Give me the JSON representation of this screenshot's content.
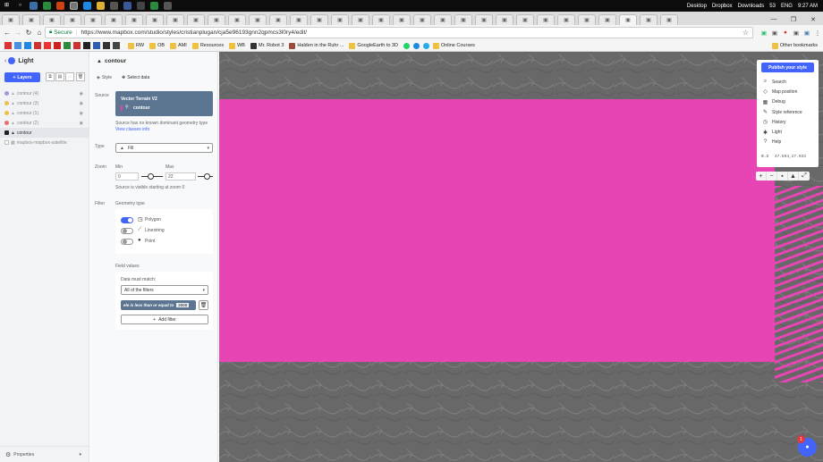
{
  "taskbar": {
    "right_items": [
      "Desktop",
      "Dropbox",
      "Downloads",
      "53",
      "ENG",
      "9:27 AM"
    ]
  },
  "addressbar": {
    "secure_label": "Secure",
    "url": "https://www.mapbox.com/studio/styles/cristianplugan/cja5e96193gnn2qpmcs3l0ry4/edit/"
  },
  "bookmarks": [
    {
      "label": "RW",
      "color": "#f0c040"
    },
    {
      "label": "OB",
      "color": "#f0c040"
    },
    {
      "label": "AMI",
      "color": "#f0c040"
    },
    {
      "label": "Resources",
      "color": "#f0c040"
    },
    {
      "label": "WB",
      "color": "#f0c040"
    },
    {
      "label": "Mr. Robot 3",
      "color": "#333333"
    },
    {
      "label": "Halden in the Ruhr ...",
      "color": "#9b4b3b"
    },
    {
      "label": "GoogleEarth to 3D",
      "color": "#f0c040"
    },
    {
      "label": "Online Courses",
      "color": "#f0c040"
    }
  ],
  "bookmarks_other": "Other bookmarks",
  "sidebar": {
    "style_name": "Light",
    "layers_button": "Layers",
    "layers": [
      {
        "name": "contour (4)",
        "color": "#9b9bdc",
        "selected": false
      },
      {
        "name": "contour (3)",
        "color": "#e8c050",
        "selected": false
      },
      {
        "name": "contour (1)",
        "color": "#f0c040",
        "selected": false
      },
      {
        "name": "contour (2)",
        "color": "#e87070",
        "selected": false
      },
      {
        "name": "contour",
        "color": "#222222",
        "selected": true
      },
      {
        "name": "mapbox-mapbox-satellite",
        "color": "#cccccc",
        "selected": false
      }
    ],
    "properties_label": "Properties"
  },
  "panel": {
    "layer_title": "contour",
    "tab_style": "Style",
    "tab_select_data": "Select data",
    "source_label": "Source",
    "source_name": "Vector Terrain V2",
    "source_layer": "contour",
    "source_note": "Source has no known dominant geometry type",
    "view_class_info": "View classes info",
    "type_label": "Type",
    "type_value": "Fill",
    "zoom_label": "Zoom",
    "min_label": "Min",
    "max_label": "Max",
    "min_value": "0",
    "max_value": "22",
    "zoom_note": "Source is visible starting at zoom 0",
    "filter_label": "Filter",
    "geometry_type_label": "Geometry type",
    "geom_polygon": "Polygon",
    "geom_linestring": "Linestring",
    "geom_point": "Point",
    "field_values_label": "Field values",
    "data_must_match": "Data must match:",
    "match_value": "All of the filters",
    "filter_text": "ele is less than or equal to",
    "filter_number": "2000",
    "add_filter": "Add filter"
  },
  "map": {
    "fill_color": "#e845b4",
    "publish_button": "Publish your style",
    "menu": [
      {
        "label": "Search",
        "icon": "search-icon"
      },
      {
        "label": "Map position",
        "icon": "map-position-icon"
      },
      {
        "label": "Debug",
        "icon": "debug-icon"
      },
      {
        "label": "Style reference",
        "icon": "style-reference-icon"
      },
      {
        "label": "History",
        "icon": "history-icon"
      },
      {
        "label": "Light",
        "icon": "light-icon"
      },
      {
        "label": "Help",
        "icon": "help-icon"
      }
    ],
    "zoom_level": "9.3",
    "coords": "47.594,27.933",
    "notification_count": "1"
  }
}
